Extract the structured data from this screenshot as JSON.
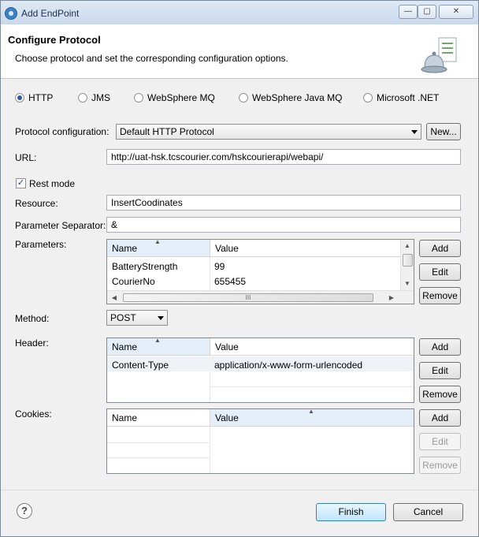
{
  "window": {
    "title": "Add EndPoint",
    "controls": {
      "minimize": "—",
      "maximize": "▢",
      "close": "✕"
    }
  },
  "header": {
    "title": "Configure Protocol",
    "subtitle": "Choose protocol and set the corresponding configuration options."
  },
  "protocols": [
    {
      "label": "HTTP",
      "selected": true
    },
    {
      "label": "JMS",
      "selected": false
    },
    {
      "label": "WebSphere MQ",
      "selected": false
    },
    {
      "label": "WebSphere Java MQ",
      "selected": false
    },
    {
      "label": "Microsoft .NET",
      "selected": false
    }
  ],
  "protocol_config": {
    "label": "Protocol configuration:",
    "value": "Default HTTP Protocol",
    "new_button": "New..."
  },
  "url": {
    "label": "URL:",
    "value": "http://uat-hsk.tcscourier.com/hskcourierapi/webapi/"
  },
  "rest_mode": {
    "label": "Rest mode",
    "checked": true,
    "check_glyph": "✓"
  },
  "resource": {
    "label": "Resource:",
    "value": "InsertCoodinates"
  },
  "param_separator": {
    "label": "Parameter Separator:",
    "value": "&"
  },
  "parameters": {
    "label": "Parameters:",
    "columns": [
      "Name",
      "Value"
    ],
    "rows": [
      {
        "name": "BatteryStrength",
        "value": "99"
      },
      {
        "name": "CourierNo",
        "value": "655455"
      }
    ],
    "buttons": {
      "add": "Add",
      "edit": "Edit",
      "remove": "Remove"
    },
    "hscroll_grip": "III"
  },
  "method": {
    "label": "Method:",
    "value": "POST"
  },
  "header_table": {
    "label": "Header:",
    "columns": [
      "Name",
      "Value"
    ],
    "rows": [
      {
        "name": "Content-Type",
        "value": "application/x-www-form-urlencoded"
      }
    ],
    "buttons": {
      "add": "Add",
      "edit": "Edit",
      "remove": "Remove"
    }
  },
  "cookies": {
    "label": "Cookies:",
    "columns": [
      "Name",
      "Value"
    ],
    "rows": [],
    "buttons": {
      "add": "Add",
      "edit": "Edit",
      "remove": "Remove"
    }
  },
  "footer": {
    "help": "?",
    "finish": "Finish",
    "cancel": "Cancel"
  }
}
